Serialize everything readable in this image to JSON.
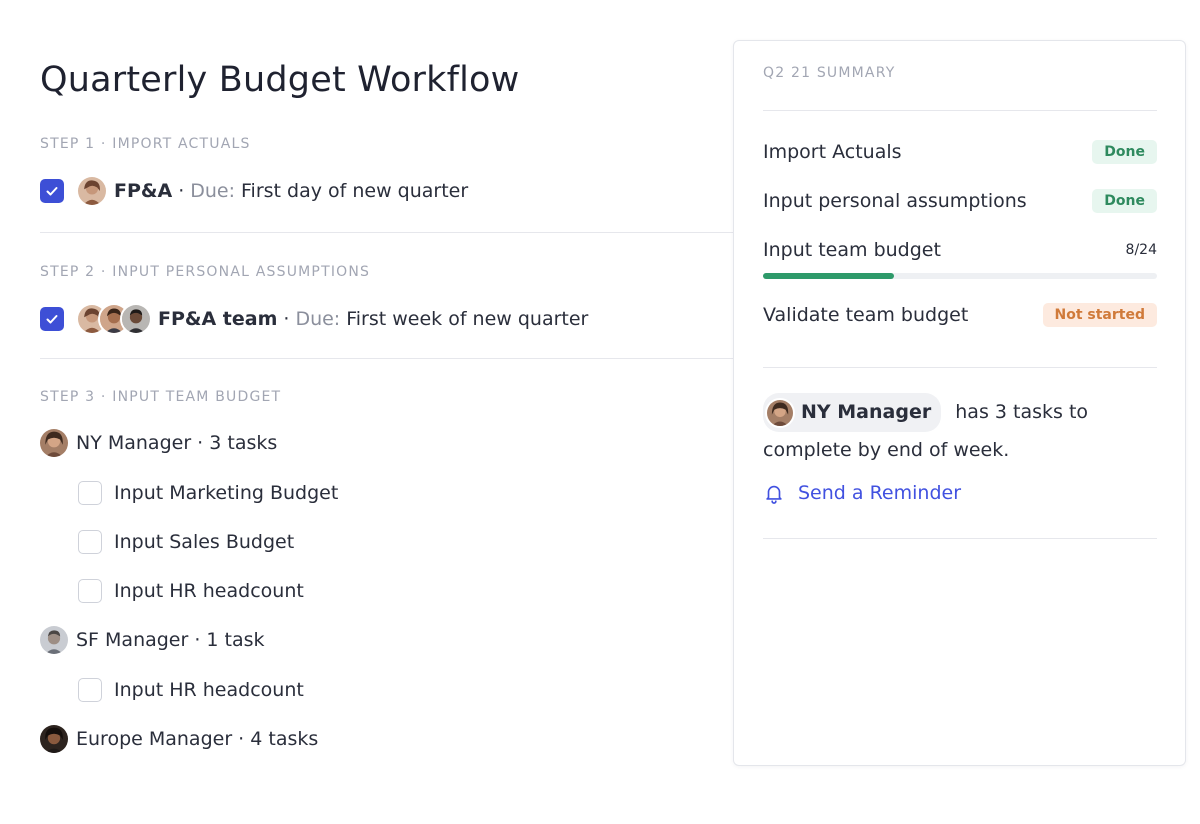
{
  "page": {
    "title": "Quarterly Budget Workflow"
  },
  "steps": [
    {
      "label": "STEP 1 · IMPORT ACTUALS",
      "checked": true,
      "owner": "FP&A",
      "separator": "·",
      "due_label": "Due:",
      "due_value": "First day of new quarter"
    },
    {
      "label": "STEP 2 · INPUT PERSONAL ASSUMPTIONS",
      "checked": true,
      "owner": "FP&A team",
      "separator": "·",
      "due_label": "Due:",
      "due_value": "First week of new quarter"
    },
    {
      "label": "STEP 3 · INPUT TEAM BUDGET",
      "managers": [
        {
          "name": "NY Manager · 3 tasks",
          "tasks": [
            "Input Marketing Budget",
            "Input Sales Budget",
            "Input HR headcount"
          ]
        },
        {
          "name": "SF Manager · 1 task",
          "tasks": [
            "Input HR headcount"
          ]
        },
        {
          "name": "Europe Manager · 4 tasks",
          "tasks": []
        }
      ]
    }
  ],
  "summary": {
    "heading": "Q2 21 SUMMARY",
    "items": [
      {
        "label": "Import Actuals",
        "status": "Done"
      },
      {
        "label": "Input personal assumptions",
        "status": "Done"
      },
      {
        "label": "Input team budget",
        "count": "8/24",
        "progress": 0.333
      },
      {
        "label": "Validate team budget",
        "status": "Not started"
      }
    ],
    "note": {
      "chip_name": "NY Manager",
      "text_after": "has 3 tasks to complete by end of week."
    },
    "reminder_label": "Send a Reminder"
  },
  "colors": {
    "accent": "#4151e0",
    "checkbox": "#3d4fd6",
    "done_bg": "#e7f6ef",
    "done_text": "#2e8a5e",
    "not_started_bg": "#fdeadf",
    "not_started_text": "#d07a3a",
    "progress": "#2e9a6a"
  },
  "icons": {
    "checkbox_checked": "check-icon",
    "reminder": "bell-icon"
  }
}
